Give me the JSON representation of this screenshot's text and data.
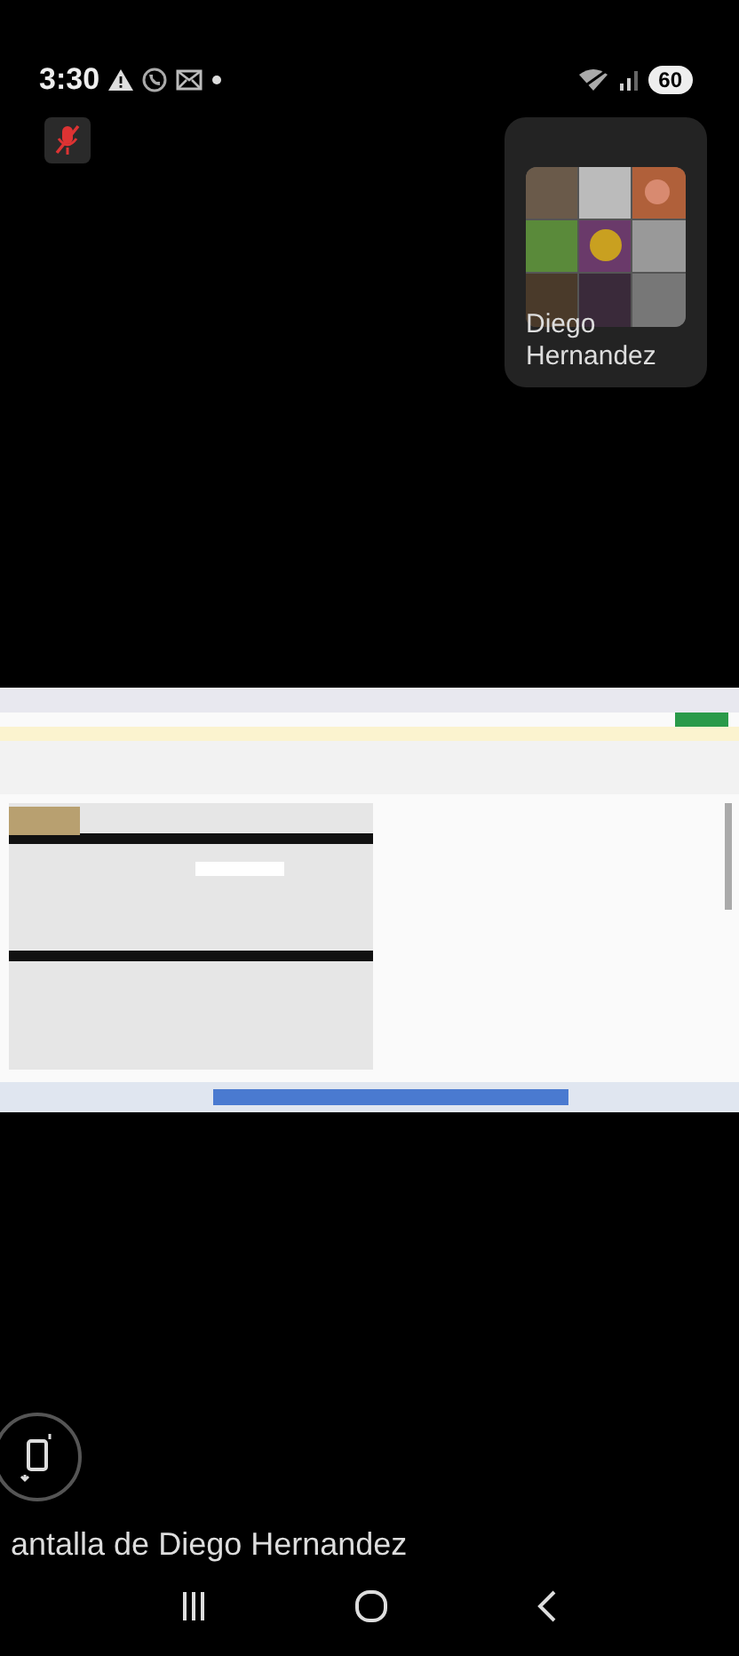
{
  "status_bar": {
    "time": "3:30",
    "battery": "60"
  },
  "microphone": {
    "muted": true
  },
  "participant_tile": {
    "name": "Diego Hernandez"
  },
  "shared_screen": {
    "caption": "antalla de Diego Hernandez"
  }
}
